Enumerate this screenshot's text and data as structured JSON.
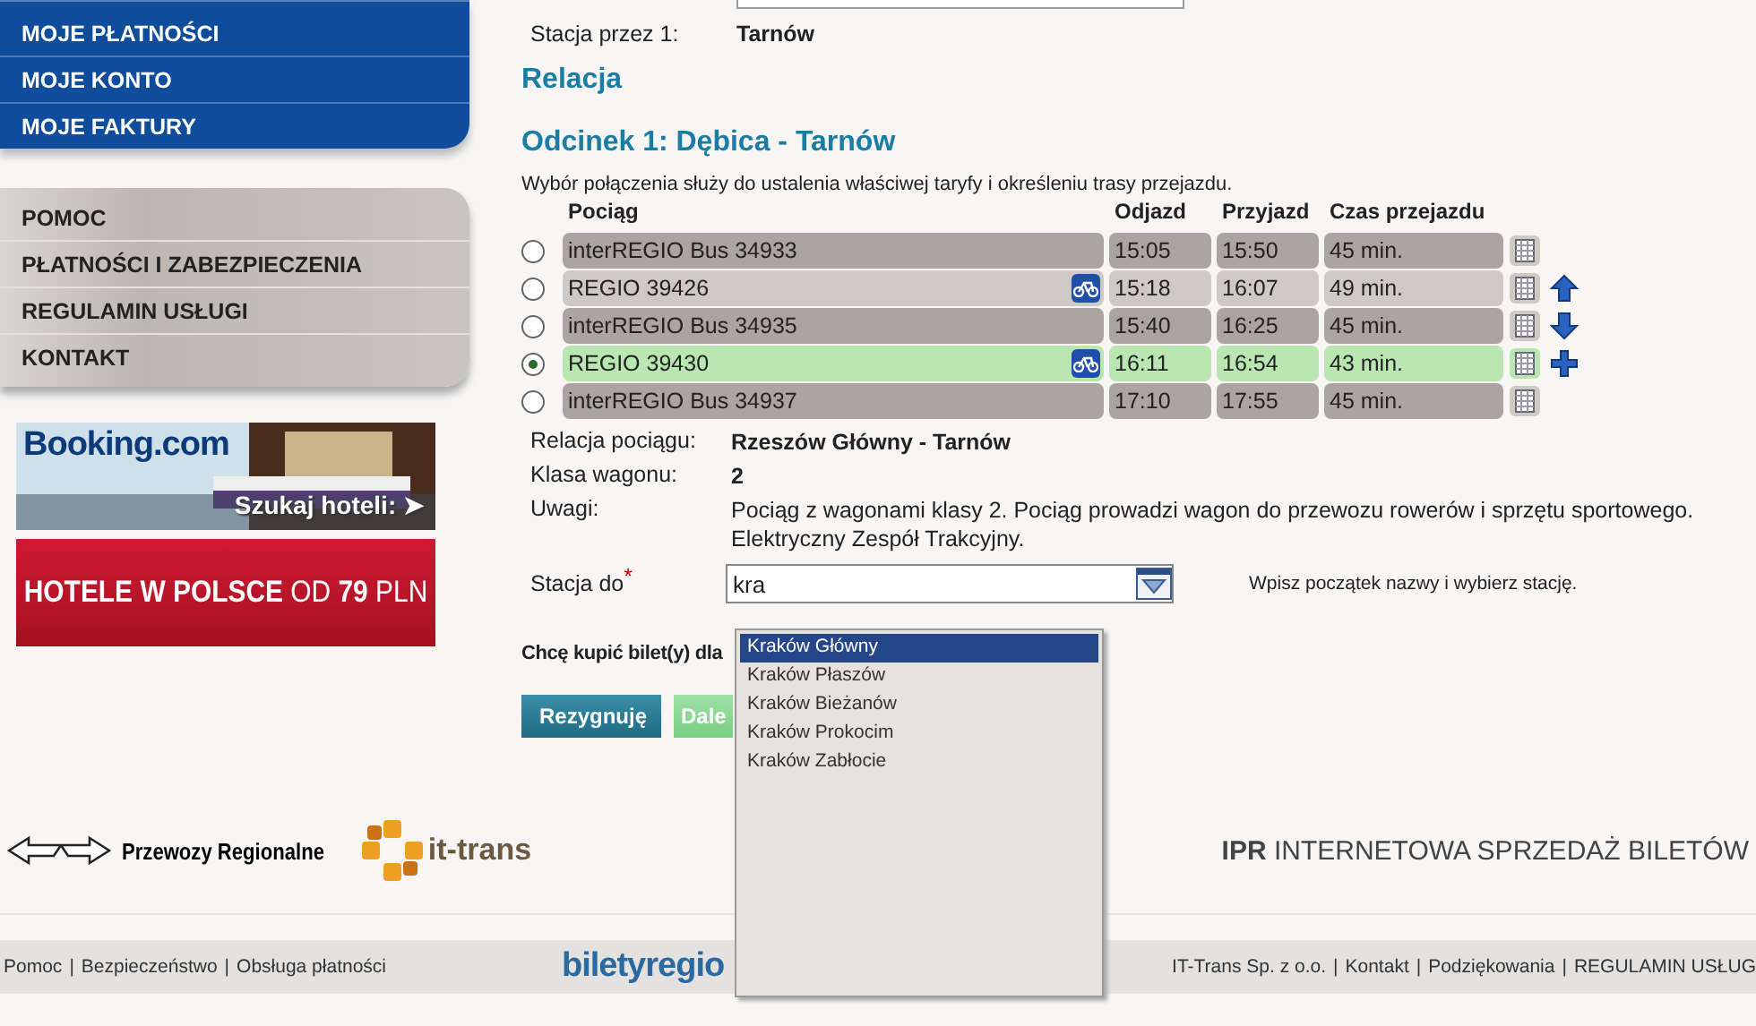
{
  "sidebar": {
    "account_menu": [
      "MOJE PŁATNOŚCI",
      "MOJE KONTO",
      "MOJE FAKTURY"
    ],
    "info_menu": [
      "POMOC",
      "PŁATNOŚCI I ZABEZPIECZENIA",
      "REGULAMIN USŁUGI",
      "KONTAKT"
    ],
    "ads": [
      {
        "kind": "booking",
        "brand": "Booking.com",
        "cta": "Szukaj hoteli: ➤"
      },
      {
        "kind": "hotels",
        "text": "**HOTELE W POLSCE** OD **79** PLN"
      }
    ]
  },
  "via_station": {
    "label": "Stacja przez 1:",
    "value": "Tarnów"
  },
  "section_title": "Relacja",
  "segment_title": "Odcinek 1: Dębica - Tarnów",
  "note": "Wybór połączenia służy do ustalenia właściwej taryfy i określeniu trasy przejazdu.",
  "table": {
    "columns": [
      "Pociąg",
      "Odjazd",
      "Przyjazd",
      "Czas przejazdu"
    ],
    "rows": [
      {
        "train": "interREGIO Bus 34933",
        "departure": "15:05",
        "arrival": "15:50",
        "duration": "45 min.",
        "bike": false,
        "selected": false,
        "kind": "plain"
      },
      {
        "train": "REGIO 39426",
        "departure": "15:18",
        "arrival": "16:07",
        "duration": "49 min.",
        "bike": true,
        "selected": false,
        "kind": "up"
      },
      {
        "train": "interREGIO Bus 34935",
        "departure": "15:40",
        "arrival": "16:25",
        "duration": "45 min.",
        "bike": false,
        "selected": false,
        "kind": "down"
      },
      {
        "train": "REGIO 39430",
        "departure": "16:11",
        "arrival": "16:54",
        "duration": "43 min.",
        "bike": true,
        "selected": true,
        "kind": "add"
      },
      {
        "train": "interREGIO Bus 34937",
        "departure": "17:10",
        "arrival": "17:55",
        "duration": "45 min.",
        "bike": false,
        "selected": false,
        "kind": "plain"
      }
    ]
  },
  "details": [
    {
      "label": "Relacja pociągu:",
      "value": "Rzeszów Główny - Tarnów",
      "kind": "bold"
    },
    {
      "label": "Klasa wagonu:",
      "value": "2",
      "kind": "bold"
    },
    {
      "label": "Uwagi:",
      "value": "Pociąg z wagonami klasy 2. Pociąg prowadzi wagon do przewozu rowerów i sprzętu sportowego. Elektryczny Zespół Trakcyjny.",
      "kind": "plain"
    }
  ],
  "destination": {
    "label": "Stacja do",
    "required_mark": "*",
    "value": "kra",
    "hint": "Wpisz początek nazwy i wybierz stację.",
    "suggestions": [
      {
        "label": "Kraków Główny",
        "selected": true
      },
      {
        "label": "Kraków Płaszów",
        "selected": false
      },
      {
        "label": "Kraków Bieżanów",
        "selected": false
      },
      {
        "label": "Kraków Prokocim",
        "selected": false
      },
      {
        "label": "Kraków Zabłocie",
        "selected": false
      }
    ]
  },
  "ticket_for_label": "Chcę kupić bilet(y) dla",
  "buttons": [
    {
      "label": "Rezygnuję",
      "kind": "cancel"
    },
    {
      "label": "Dale",
      "kind": "next"
    }
  ],
  "footer": {
    "carrier": "Przewozy Regionalne",
    "partner": "it-trans",
    "tagline": "**IPR** INTERNETOWA SPRZEDAŻ BILETÓW",
    "left_links": [
      {
        "kind": "link",
        "label": "Pomoc"
      },
      {
        "kind": "separator",
        "label": "|"
      },
      {
        "kind": "link",
        "label": "Bezpieczeństwo"
      },
      {
        "kind": "separator",
        "label": "|"
      },
      {
        "kind": "link",
        "label": "Obsługa płatności"
      }
    ],
    "site_logo": "biletyregio",
    "right_links": [
      {
        "kind": "link",
        "label": "IT-Trans Sp. z o.o."
      },
      {
        "kind": "separator",
        "label": "|"
      },
      {
        "kind": "link",
        "label": "Kontakt"
      },
      {
        "kind": "separator",
        "label": "|"
      },
      {
        "kind": "link",
        "label": "Podziękowania"
      },
      {
        "kind": "separator",
        "label": "|"
      },
      {
        "kind": "link",
        "label": "REGULAMIN USŁUG"
      }
    ]
  }
}
